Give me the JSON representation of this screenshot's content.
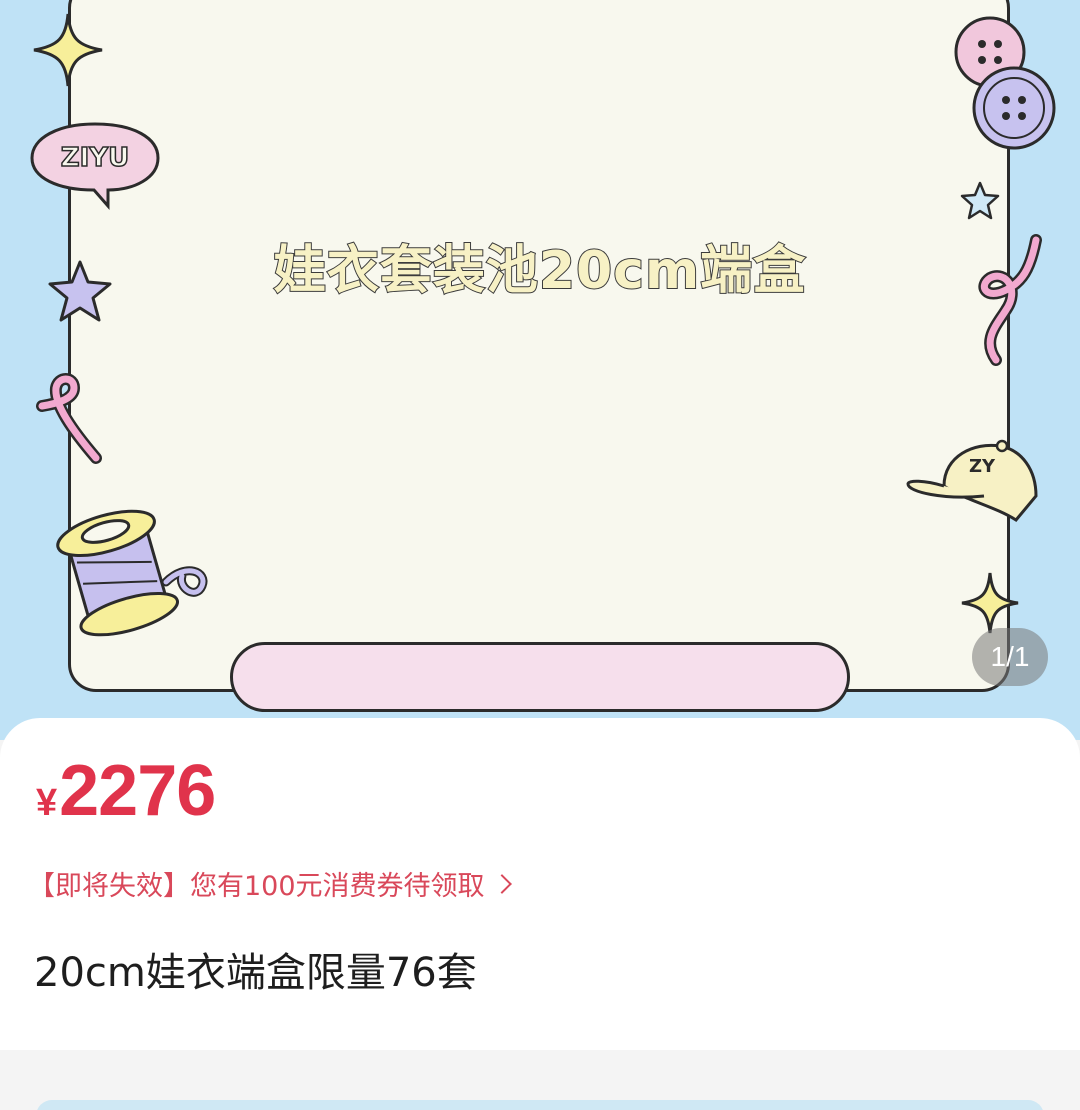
{
  "banner": {
    "title": "娃衣套装池20cm端盒",
    "badge_text": "ZIYU",
    "cap_text": "ZY",
    "counter": "1/1"
  },
  "product": {
    "currency": "¥",
    "price": "2276",
    "coupon": "【即将失效】您有100元消费券待领取",
    "title": "20cm娃衣端盒限量76套"
  },
  "colors": {
    "price": "#e0334b",
    "coupon": "#d9485a",
    "banner_bg": "#bfe2f6",
    "card_bg": "#f8f8ee",
    "pill": "#f6dfec"
  },
  "icons": [
    "star-icon",
    "speech-bubble-icon",
    "thread-spool-icon",
    "button-icon",
    "cap-icon",
    "ribbon-icon",
    "chevron-right-icon"
  ]
}
